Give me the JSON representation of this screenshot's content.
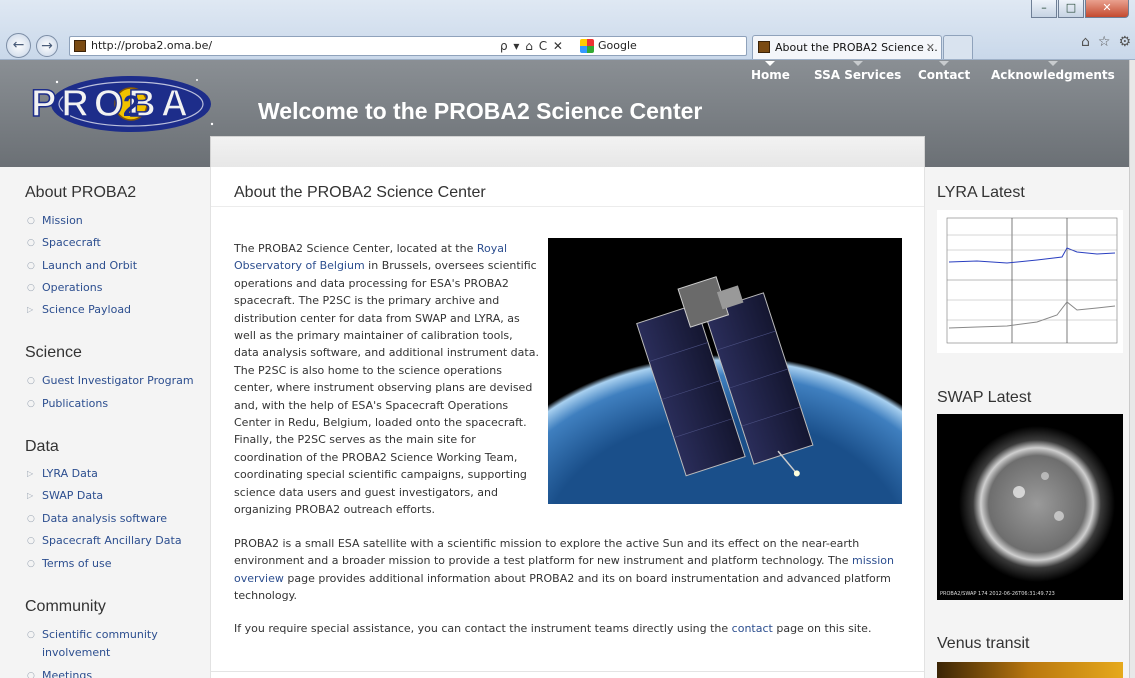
{
  "browser": {
    "url": "http://proba2.oma.be/",
    "search_engine": "Google",
    "tab_title": "About the PROBA2 Science ...",
    "addr_tools": "ρ ▾ ⌂ C ✕",
    "close_symbol": "✕"
  },
  "header": {
    "logo_text": "PROBA",
    "site_title": "Welcome to the PROBA2 Science Center",
    "nav": [
      "Home",
      "SSA Services",
      "Contact",
      "Acknowledgments"
    ]
  },
  "sidebar": {
    "sections": [
      {
        "title": "About PROBA2",
        "items": [
          {
            "label": "Mission",
            "marker": "circle"
          },
          {
            "label": "Spacecraft",
            "marker": "circle"
          },
          {
            "label": "Launch and Orbit",
            "marker": "circle"
          },
          {
            "label": "Operations",
            "marker": "circle"
          },
          {
            "label": "Science Payload",
            "marker": "triangle"
          }
        ]
      },
      {
        "title": "Science",
        "items": [
          {
            "label": "Guest Investigator Program",
            "marker": "circle"
          },
          {
            "label": "Publications",
            "marker": "circle"
          }
        ]
      },
      {
        "title": "Data",
        "items": [
          {
            "label": "LYRA Data",
            "marker": "triangle"
          },
          {
            "label": "SWAP Data",
            "marker": "triangle"
          },
          {
            "label": "Data analysis software",
            "marker": "circle"
          },
          {
            "label": "Spacecraft Ancillary Data",
            "marker": "circle"
          },
          {
            "label": "Terms of use",
            "marker": "circle"
          }
        ]
      },
      {
        "title": "Community",
        "items": [
          {
            "label": "Scientific community involvement",
            "marker": "circle"
          },
          {
            "label": "Meetings",
            "marker": "circle"
          }
        ]
      }
    ]
  },
  "main": {
    "title": "About the PROBA2 Science Center",
    "p1": {
      "before": "The PROBA2 Science Center, located at the ",
      "link": "Royal Observatory of Belgium",
      "after": " in Brussels, oversees scientific operations and data processing for ESA's PROBA2 spacecraft. The P2SC is the primary archive and distribution center for data from SWAP and LYRA, as well as the primary maintainer of calibration tools, data analysis software, and additional instrument data. The P2SC is also home to the science operations center, where instrument observing plans are devised and, with the help of ESA's Spacecraft Operations Center in Redu, Belgium, loaded onto the spacecraft. Finally, the P2SC serves as the main site for coordination of the PROBA2 Science Working Team, coordinating special scientific campaigns, supporting science data users and guest investigators, and organizing PROBA2 outreach efforts."
    },
    "p2": {
      "before": "PROBA2 is a small ESA satellite with a scientific mission to explore the active Sun and its effect on the near-earth environment and a broader mission to provide a test platform for new instrument and platform technology. The ",
      "link": "mission overview",
      "after": " page provides additional information about PROBA2 and its on board instrumentation and advanced platform technology."
    },
    "p3": {
      "before": "If you require special assistance, you can contact the instrument teams directly using the ",
      "link": "contact",
      "after": " page on this site."
    }
  },
  "rightcol": {
    "lyra_title": "LYRA Latest",
    "swap_title": "SWAP Latest",
    "swap_caption": "PROBA2/SWAP 174  2012-06-26T06:31:49.723",
    "venus_title": "Venus transit"
  },
  "colors": {
    "link": "#2c4e8f",
    "header_bg": "#7c8186",
    "text": "#333333"
  }
}
